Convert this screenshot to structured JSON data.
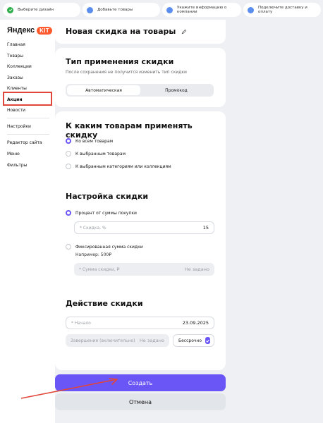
{
  "steps": [
    {
      "label": "Выберите дизайн",
      "done": true
    },
    {
      "label": "Добавьте товары",
      "done": false
    },
    {
      "label": "Укажите информацию о компании",
      "done": false
    },
    {
      "label": "Подключите доставку и оплату",
      "done": false
    }
  ],
  "brand": {
    "name": "Яндекс",
    "badge": "KIT"
  },
  "sidebar": {
    "items": [
      {
        "label": "Главная"
      },
      {
        "label": "Товары"
      },
      {
        "label": "Коллекции"
      },
      {
        "label": "Заказы"
      },
      {
        "label": "Клиенты"
      },
      {
        "label": "Акции"
      },
      {
        "label": "Новости"
      },
      {
        "label": "Настройки"
      },
      {
        "label": "Редактор сайта"
      },
      {
        "label": "Меню"
      },
      {
        "label": "Фильтры"
      }
    ]
  },
  "page": {
    "title": "Новая скидка на товары"
  },
  "type_card": {
    "title": "Тип применения скидки",
    "subtitle": "После сохранения не получится изменить тип скидки",
    "options": [
      "Автоматическая",
      "Промокод"
    ]
  },
  "apply_card": {
    "title": "К каким товарам применять скидку",
    "options": [
      "Ко всем товарам",
      "К выбранным товарам",
      "К выбранным категориям или коллекциям"
    ]
  },
  "setup_card": {
    "title": "Настройка скидки",
    "percent_label": "Процент от суммы покупки",
    "percent_placeholder": "* Скидка, %",
    "percent_value": "15",
    "fixed_label": "Фиксированная сумма скидки",
    "fixed_hint": "Например: 500₽",
    "fixed_placeholder": "* Сумма скидки, ₽",
    "fixed_value": "Не задано"
  },
  "action_card": {
    "title": "Действие скидки",
    "start_placeholder": "* Начало",
    "start_value": "23.09.2025",
    "end_placeholder": "Завершение (включительно)",
    "end_value": "Не задано",
    "indefinite_label": "Бессрочно"
  },
  "buttons": {
    "create": "Создать",
    "cancel": "Отмена"
  },
  "colors": {
    "accent": "#6a55f7",
    "highlight": "#e0463a",
    "brand_badge": "#ff5a2e"
  }
}
